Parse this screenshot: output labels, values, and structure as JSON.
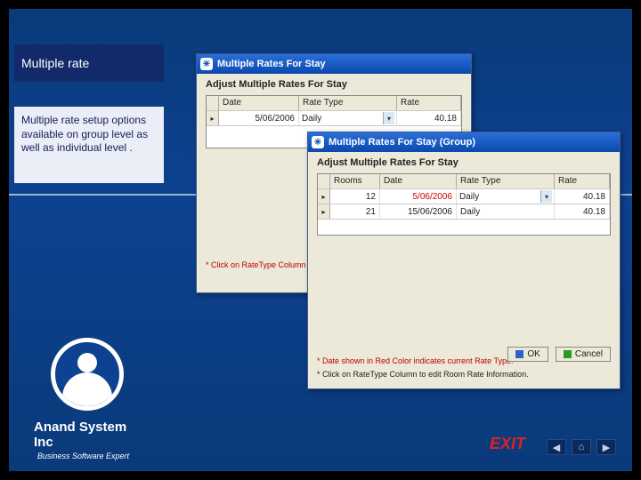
{
  "slide": {
    "title": "Multiple rate",
    "description": "Multiple rate setup options available on group level as well as individual level .",
    "company": "Anand System Inc",
    "tagline": "Business Software Expert",
    "exit_label": "EXIT"
  },
  "dialog1": {
    "title": "Multiple Rates For Stay",
    "subtitle": "Adjust Multiple Rates For Stay",
    "headers": {
      "date": "Date",
      "rate_type": "Rate Type",
      "rate": "Rate"
    },
    "row": {
      "date": "5/06/2006",
      "rate_type": "Daily",
      "rate": "40.18"
    },
    "note": "Click on RateType Column to Room Rate Information."
  },
  "dialog2": {
    "title": "Multiple Rates For Stay (Group)",
    "subtitle": "Adjust Multiple Rates For Stay",
    "headers": {
      "rooms": "Rooms",
      "date": "Date",
      "rate_type": "Rate Type",
      "rate": "Rate"
    },
    "rows": [
      {
        "rooms": "12",
        "date": "5/06/2006",
        "rate_type": "Daily",
        "rate": "40.18",
        "current": true
      },
      {
        "rooms": "21",
        "date": "15/06/2006",
        "rate_type": "Daily",
        "rate": "40.18",
        "current": false
      }
    ],
    "note1": "Date shown in Red Color indicates current Rate Type.",
    "note2": "Click on RateType Column to edit Room Rate Information.",
    "ok_label": "OK",
    "cancel_label": "Cancel"
  }
}
